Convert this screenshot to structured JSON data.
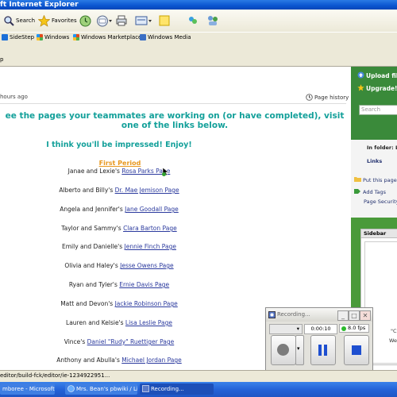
{
  "window": {
    "title": "ft Internet Explorer"
  },
  "toolbar": {
    "search_label": "Search",
    "favorites_label": "Favorites"
  },
  "links": [
    {
      "label": "SideStep",
      "icon": "sidestep-icon",
      "color": "#1c6fd8"
    },
    {
      "label": "Windows",
      "icon": "windows-flag-icon",
      "color": "#e04a1c"
    },
    {
      "label": "Windows Marketplace",
      "icon": "windows-flag-icon",
      "color": "#e04a1c"
    },
    {
      "label": "Windows Media",
      "icon": "media-icon",
      "color": "#3b6fc4"
    }
  ],
  "address": {
    "text": "p"
  },
  "page": {
    "updated": "hours ago",
    "history_label": "Page history",
    "heading": "ee the pages your teammates are working on (or have completed), visit one of the links below.",
    "subheading": "I think you'll be impressed! Enjoy!",
    "period": "First Period",
    "entries": [
      {
        "names": "Janae and Lexie's ",
        "link": "Rosa Parks Page"
      },
      {
        "names": "Alberto and Billy's ",
        "link": "Dr. Mae Jemison Page "
      },
      {
        "names": "Angela and Jennifer's ",
        "link": "Jane Goodall Page"
      },
      {
        "names": "Taylor and Sammy's ",
        "link": "Clara Barton Page"
      },
      {
        "names": "Emily and Danielle's ",
        "link": "Jennie Finch Page"
      },
      {
        "names": "Olivia and Haley's ",
        "link": "Jesse Owens Page"
      },
      {
        "names": "Ryan and Tyler's ",
        "link": "Ernie Davis Page"
      },
      {
        "names": "Matt and Devon's ",
        "link": "Jackie Robinson Page"
      },
      {
        "names": "Lauren and Kelsie's ",
        "link": "Lisa Leslie Page"
      },
      {
        "names": "Vince's ",
        "link": "Daniel \"Rudy\" Ruettiger Page"
      },
      {
        "names": "Anthony and Abulla's ",
        "link": "Michael Jordan Page"
      }
    ]
  },
  "right_panel": {
    "upload": "Upload fil",
    "upgrade": "Upgrade!",
    "search_placeholder": "Search",
    "in_folder": "In folder: L",
    "links_label": "Links",
    "put_page": "Put this page",
    "add_tags": "Add Tags",
    "page_security": "Page Security",
    "sidebar_title": "Sidebar",
    "sidebar_text_1": "\"C",
    "sidebar_text_2": "We"
  },
  "recorder": {
    "title": "Recording...",
    "time": "0:00:10",
    "fps": "8.0 fps"
  },
  "status": {
    "text": "editor/build-fck/editor/ie-1234922951..."
  },
  "taskbar": [
    {
      "label": "mboree - Microsoft..."
    },
    {
      "label": "Mrs. Bean's pbwiki / Li..."
    },
    {
      "label": "Recording..."
    }
  ],
  "colors": {
    "heading": "#13a09a",
    "period": "#e8971e",
    "link": "#2b3a9e",
    "sidebar_green": "#3a8a3a",
    "taskbar_blue": "#2463d8"
  }
}
